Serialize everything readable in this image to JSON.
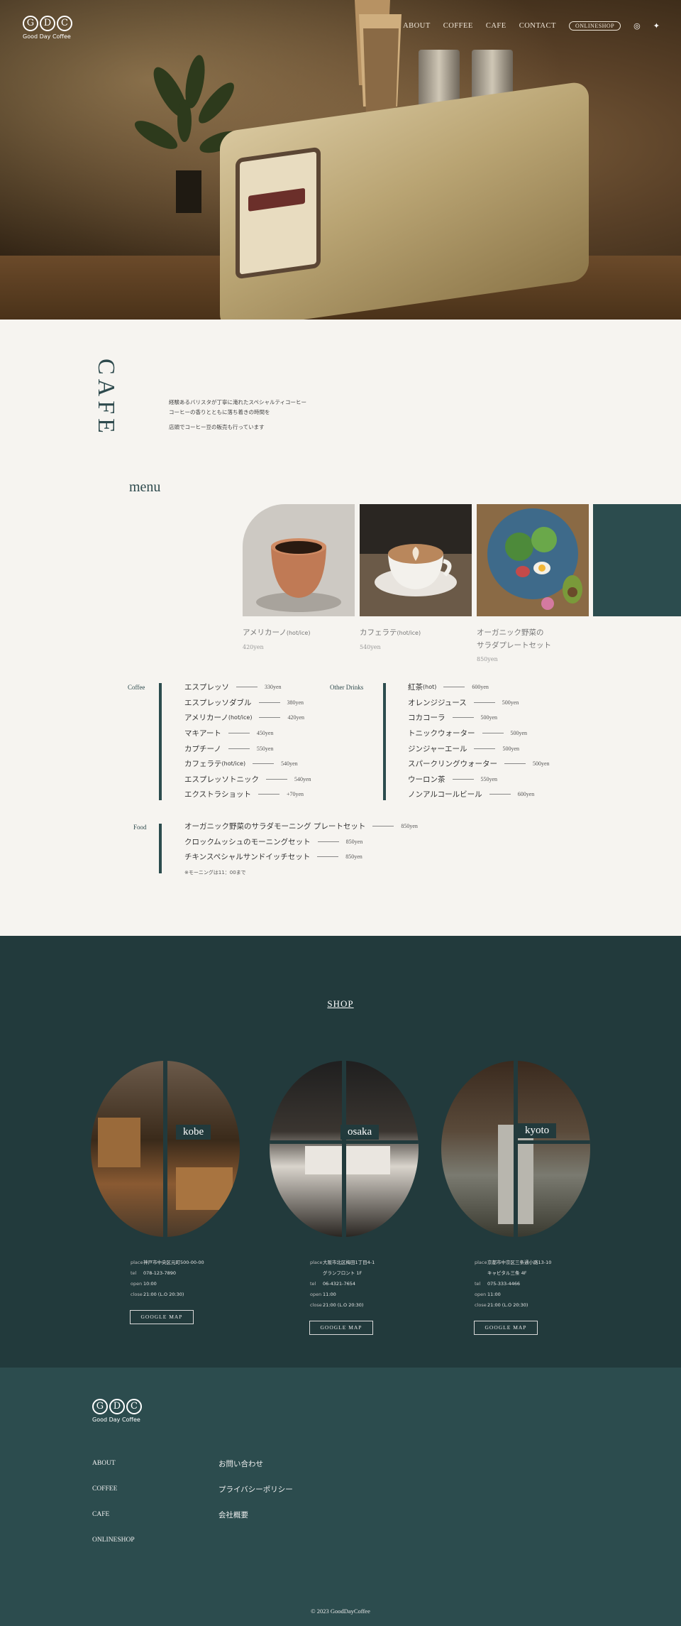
{
  "brand": {
    "mark_letters": [
      "G",
      "D",
      "C"
    ],
    "name": "Good Day Coffee"
  },
  "nav": {
    "items": [
      "ABOUT",
      "COFFEE",
      "CAFE",
      "CONTACT"
    ],
    "shop_button": "ONLINESHOP",
    "icons": [
      "instagram-icon",
      "twitter-icon"
    ]
  },
  "cafe": {
    "title": "CAFE",
    "intro": [
      "経験あるバリスタが丁寧に淹れたスペシャルティコーヒー",
      "コーヒーの香りとともに落ち着きの時間を",
      "店頭でコーヒー豆の販売も行っています"
    ],
    "menu_heading": "menu",
    "cards": [
      {
        "name": "アメリカーノ",
        "note": "(hot/ice)",
        "price": "420yen"
      },
      {
        "name": "カフェラテ",
        "note": "(hot/ice)",
        "price": "540yen"
      },
      {
        "name": "オーガニック野菜の",
        "name2": "サラダプレートセット",
        "note": "",
        "price": "850yen"
      }
    ]
  },
  "menu": {
    "coffee": {
      "label": "Coffee",
      "items": [
        {
          "name": "エスプレッソ",
          "price": "330yen"
        },
        {
          "name": "エスプレッソダブル",
          "price": "380yen"
        },
        {
          "name": "アメリカーノ",
          "note": "(hot/ice)",
          "price": "420yen"
        },
        {
          "name": "マキアート",
          "price": "450yen"
        },
        {
          "name": "カプチーノ",
          "price": "550yen"
        },
        {
          "name": "カフェラテ",
          "note": "(hot/ice)",
          "price": "540yen"
        },
        {
          "name": "エスプレッソトニック",
          "price": "540yen"
        },
        {
          "name": "エクストラショット",
          "price": "+70yen"
        }
      ]
    },
    "drinks": {
      "label": "Other Drinks",
      "items": [
        {
          "name": "紅茶",
          "note": "(hot)",
          "price": "600yen"
        },
        {
          "name": "オレンジジュース",
          "price": "500yen"
        },
        {
          "name": "コカコーラ",
          "price": "500yen"
        },
        {
          "name": "トニックウォーター",
          "price": "500yen"
        },
        {
          "name": "ジンジャーエール",
          "price": "500yen"
        },
        {
          "name": "スパークリングウォーター",
          "price": "500yen"
        },
        {
          "name": "ウーロン茶",
          "price": "550yen"
        },
        {
          "name": "ノンアルコールビール",
          "price": "600yen"
        }
      ]
    },
    "food": {
      "label": "Food",
      "items": [
        {
          "name": "オーガニック野菜のサラダモーニング プレートセット",
          "price": "850yen"
        },
        {
          "name": "クロックムッシュのモーニングセット",
          "price": "850yen"
        },
        {
          "name": "チキンスペシャルサンドイッチセット",
          "price": "850yen"
        }
      ],
      "note": "※モーニングは11：00まで"
    }
  },
  "shop": {
    "heading": "SHOP",
    "map_button": "GOOGLE MAP",
    "labels": {
      "place": "place",
      "tel": "tel",
      "open": "open",
      "close": "close"
    },
    "stores": [
      {
        "name": "kobe",
        "place": "神戸市中央区元町500-00-00",
        "place2": "",
        "tel": "078-123-7890",
        "open": "10:00",
        "close": "21:00 (L.O 20:30)"
      },
      {
        "name": "osaka",
        "place": "大阪市北区梅田1丁目4-1",
        "place2": "グランフロント 1F",
        "tel": "06-4321-7654",
        "open": "11:00",
        "close": "21:00 (L.O 20:30)"
      },
      {
        "name": "kyoto",
        "place": "京都市中京区三条通小路13-10",
        "place2": "キャピタル三条 4F",
        "tel": "075-333-4466",
        "open": "11:00",
        "close": "21:00 (L.O 20:30)"
      }
    ]
  },
  "footer": {
    "links": [
      "ABOUT",
      "COFFEE",
      "CAFE",
      "ONLINESHOP"
    ],
    "links2": [
      "お問い合わせ",
      "プライバシーポリシー",
      "会社概要"
    ],
    "copyright": "© 2023 GoodDayCoffee"
  },
  "colors": {
    "teal_dark": "#223a3c",
    "teal": "#2c4c4e",
    "cream": "#f6f4f0"
  }
}
